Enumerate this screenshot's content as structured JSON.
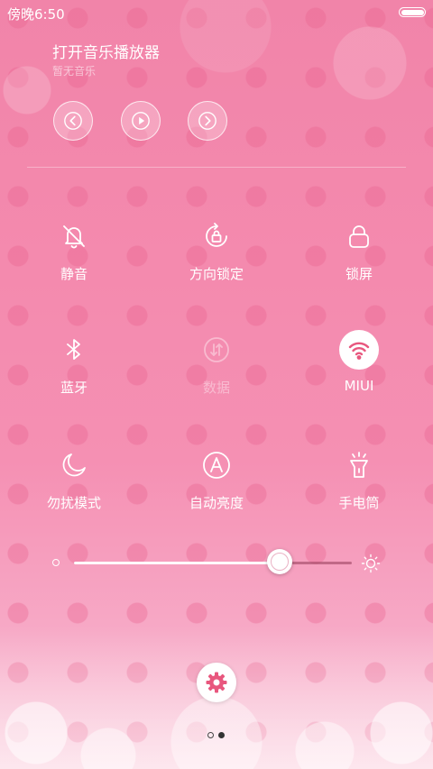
{
  "status_bar": {
    "time": "傍晚6:50"
  },
  "music": {
    "title": "打开音乐播放器",
    "subtitle": "暂无音乐",
    "controls": [
      "previous-icon",
      "play-icon",
      "next-icon"
    ]
  },
  "toggles": [
    {
      "label": "静音",
      "icon": "bell-off-icon",
      "state": "off"
    },
    {
      "label": "方向锁定",
      "icon": "rotation-lock-icon",
      "state": "off"
    },
    {
      "label": "锁屏",
      "icon": "lock-icon",
      "state": "off"
    },
    {
      "label": "蓝牙",
      "icon": "bluetooth-icon",
      "state": "off"
    },
    {
      "label": "数据",
      "icon": "mobile-data-icon",
      "state": "disabled"
    },
    {
      "label": "MIUI",
      "icon": "wifi-icon",
      "state": "on"
    },
    {
      "label": "勿扰模式",
      "icon": "moon-icon",
      "state": "off"
    },
    {
      "label": "自动亮度",
      "icon": "auto-brightness-icon",
      "state": "off"
    },
    {
      "label": "手电筒",
      "icon": "flashlight-icon",
      "state": "off"
    }
  ],
  "brightness": {
    "level": 0.74
  },
  "pager": {
    "total": 2,
    "current": 2
  },
  "colors": {
    "accent": "#e8577e",
    "background": "#f48aae"
  }
}
